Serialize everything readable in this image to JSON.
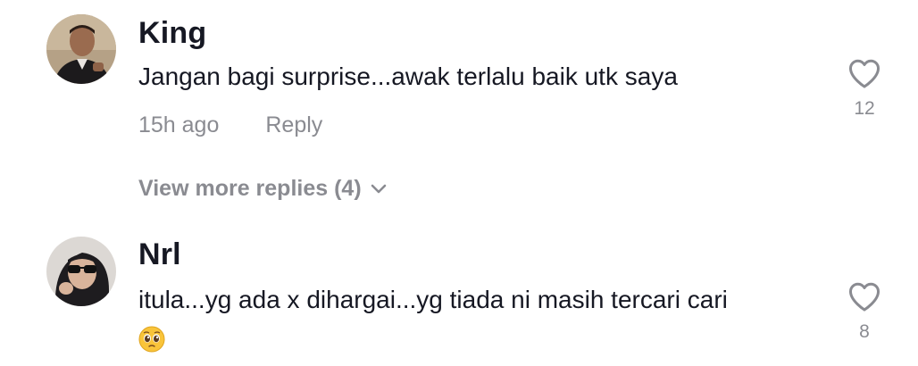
{
  "comments": [
    {
      "username": "King",
      "text": "Jangan bagi surprise...awak terlalu baik utk saya",
      "time": "15h ago",
      "reply_label": "Reply",
      "likes": "12",
      "avatar_icon": "profile-photo-man",
      "view_more_replies": "View more replies (4)"
    },
    {
      "username": "Nrl",
      "text": "itula...yg ada x dihargai...yg tiada ni masih tercari cari",
      "emoji": "pleading-face-emoji",
      "likes": "8",
      "avatar_icon": "profile-photo-woman-sunglasses"
    }
  ],
  "icons": {
    "like": "heart-outline-icon",
    "expand": "chevron-down-icon"
  },
  "colors": {
    "text_primary": "#161823",
    "text_secondary": "#8a8b91",
    "background": "#ffffff"
  }
}
